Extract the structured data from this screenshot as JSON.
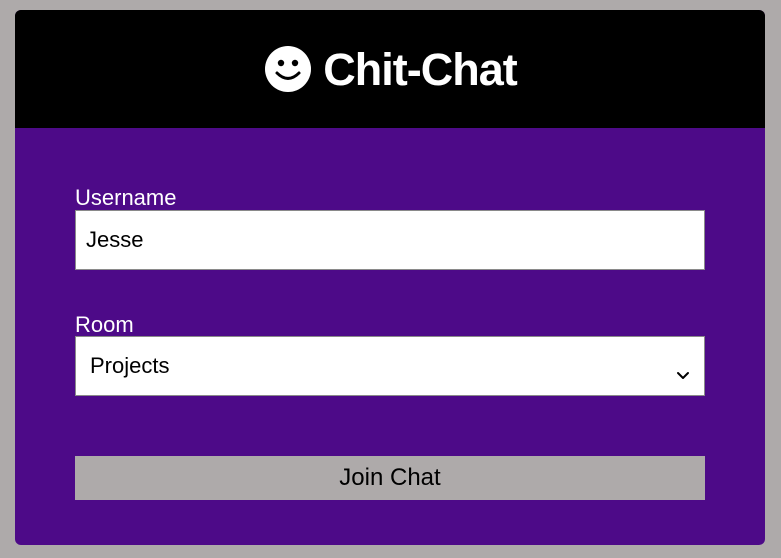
{
  "header": {
    "icon": "smiley-face-icon",
    "title": "Chit-Chat"
  },
  "form": {
    "username_label": "Username",
    "username_value": "Jesse",
    "room_label": "Room",
    "room_selected": "Projects",
    "room_dropdown_icon": "chevron-down-icon",
    "join_button_label": "Join Chat"
  },
  "colors": {
    "page_background": "#aeaaaa",
    "header_background": "#000000",
    "form_background": "#4d0a88",
    "button_background": "#aeaaaa",
    "text_light": "#ffffff"
  }
}
